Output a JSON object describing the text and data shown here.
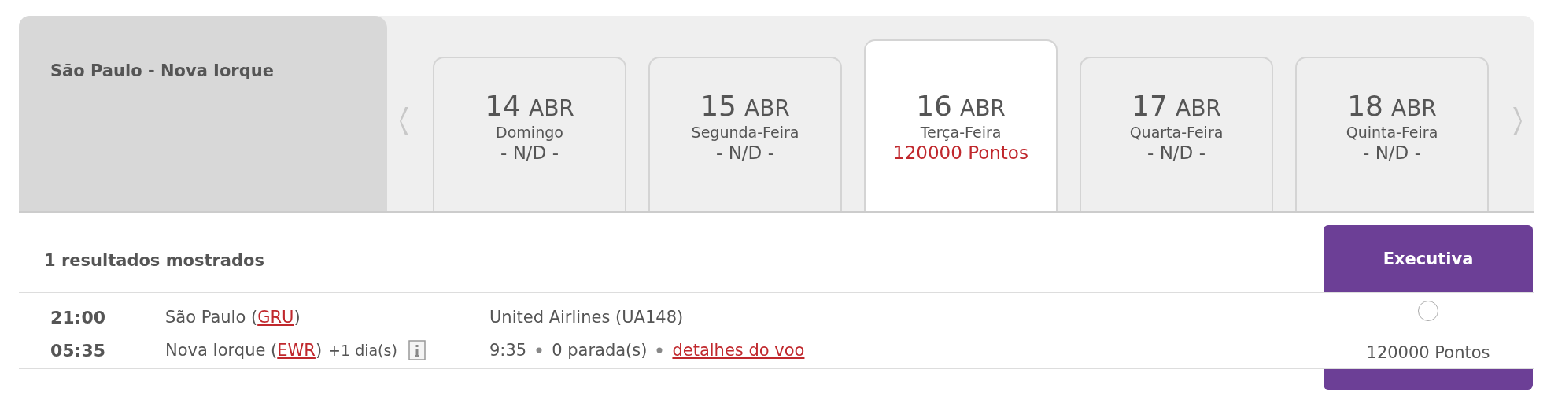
{
  "route": {
    "title": "São Paulo - Nova Iorque"
  },
  "date_tabs": [
    {
      "day": "14",
      "month": "ABR",
      "weekday": "Domingo",
      "price": "- N/D -",
      "available": false,
      "selected": false
    },
    {
      "day": "15",
      "month": "ABR",
      "weekday": "Segunda-Feira",
      "price": "- N/D -",
      "available": false,
      "selected": false
    },
    {
      "day": "16",
      "month": "ABR",
      "weekday": "Terça-Feira",
      "price": "120000 Pontos",
      "available": true,
      "selected": true
    },
    {
      "day": "17",
      "month": "ABR",
      "weekday": "Quarta-Feira",
      "price": "- N/D -",
      "available": false,
      "selected": false
    },
    {
      "day": "18",
      "month": "ABR",
      "weekday": "Quinta-Feira",
      "price": "- N/D -",
      "available": false,
      "selected": false
    }
  ],
  "results": {
    "count_label": "1 resultados mostrados",
    "cabin": "Executiva"
  },
  "flights": [
    {
      "departure_time": "21:00",
      "origin_prefix": "São Paulo (",
      "origin_code": "GRU",
      "origin_suffix": ")",
      "airline": "United Airlines (UA148)",
      "arrival_time": "05:35",
      "destination_prefix": "Nova Iorque (",
      "destination_code": "EWR",
      "destination_suffix": ")",
      "day_offset": "+1 dia(s)",
      "duration": "9:35",
      "stops": "0 parada(s)",
      "details_link": "detalhes do voo",
      "fare_selected": false,
      "fare_price": "120000 Pontos"
    }
  ]
}
